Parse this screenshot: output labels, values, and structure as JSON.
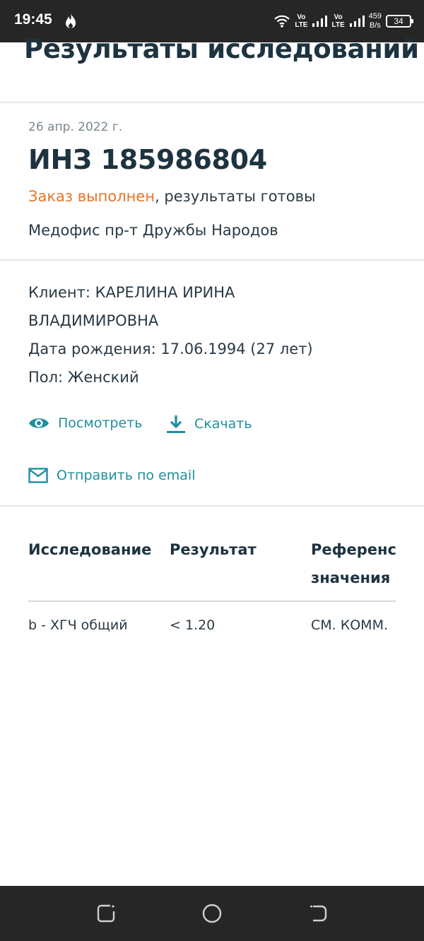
{
  "status_bar": {
    "time": "19:45",
    "flame_icon": "flame-icon",
    "wifi_icon": "wifi-icon",
    "volte1_top": "Vo",
    "volte1_bottom": "LTE",
    "volte2_top": "Vo",
    "volte2_bottom": "LTE",
    "speed_value": "459",
    "speed_unit": "B/s",
    "battery": "34"
  },
  "header": {
    "title": "Результаты исследований"
  },
  "order": {
    "date": "26 апр. 2022 г.",
    "number": "ИНЗ 185986804",
    "status_accent": "Заказ выполнен",
    "status_rest": ", результаты готовы",
    "office": "Медофис пр-т Дружбы Народов"
  },
  "client": {
    "name_line1": "Клиент: КАРЕЛИНА ИРИНА",
    "name_line2": "ВЛАДИМИРОВНА",
    "birth": "Дата рождения: 17.06.1994 (27 лет)",
    "gender": "Пол: Женский"
  },
  "actions": {
    "view_label": "Посмотреть",
    "download_label": "Скачать",
    "email_label": "Отправить по email"
  },
  "table": {
    "headers": [
      "Исследование",
      "Результат",
      "Референсные значения"
    ],
    "header_col3_line1": "Референсі",
    "header_col3_line2": "значения",
    "rows": [
      {
        "test": "b - ХГЧ общий",
        "result": "< 1.20",
        "reference": "СМ. КОММ."
      }
    ]
  },
  "colors": {
    "accent_teal": "#1e8f9e",
    "accent_orange": "#e2762a",
    "title_dark": "#1d3340",
    "system_bar": "#262626"
  }
}
